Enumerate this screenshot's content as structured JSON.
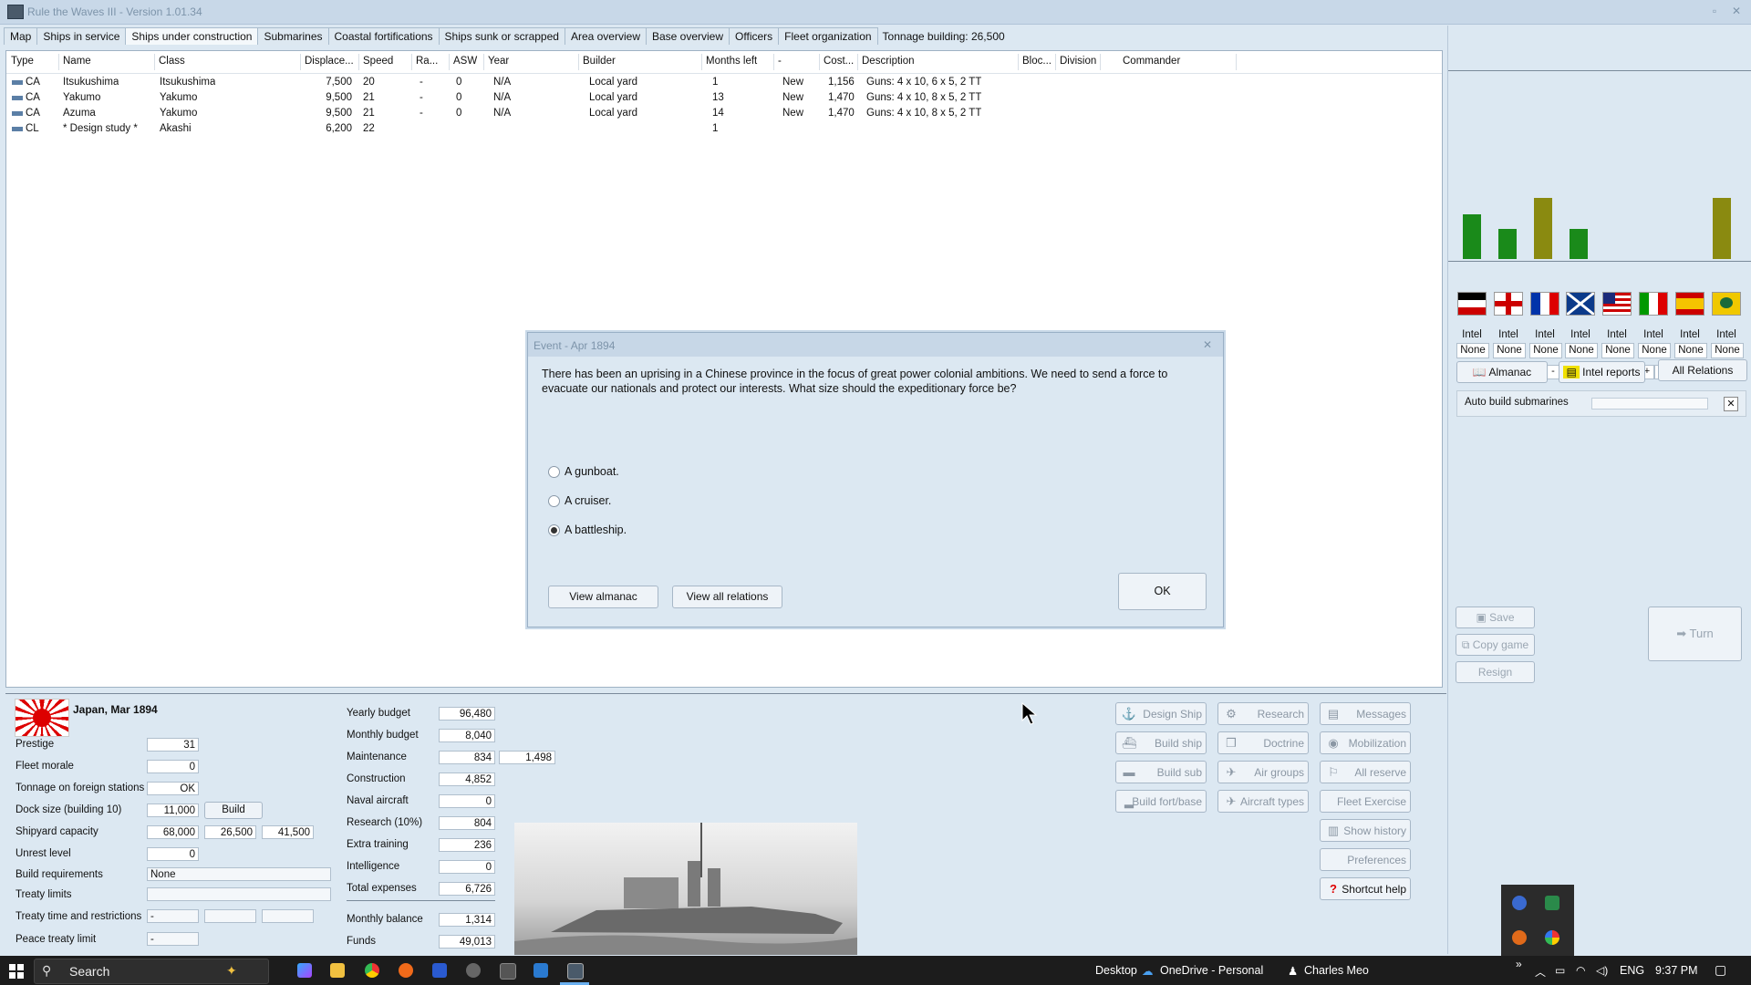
{
  "window": {
    "title": "Rule the Waves III - Version 1.01.34"
  },
  "tabs": [
    "Map",
    "Ships in service",
    "Ships under construction",
    "Submarines",
    "Coastal fortifications",
    "Ships sunk or scrapped",
    "Area overview",
    "Base overview",
    "Officers",
    "Fleet organization"
  ],
  "active_tab": "Ships under construction",
  "tonnage_building": "Tonnage building: 26,500",
  "table": {
    "columns": [
      "Type",
      "Name",
      "Class",
      "Displace...",
      "Speed",
      "Ra...",
      "ASW",
      "Year",
      "Builder",
      "Months left",
      "-",
      "Cost...",
      "Description",
      "Bloc...",
      "Division",
      "Commander"
    ],
    "rows": [
      {
        "type": "CA",
        "name": "Itsukushima",
        "class": "Itsukushima",
        "displacement": "7,500",
        "speed": "20",
        "range": "-",
        "asw": "0",
        "year": "N/A",
        "builder": "Local yard",
        "months": "1",
        "status": "New",
        "cost": "1,156",
        "desc": "Guns: 4 x 10, 6 x 5, 2 TT"
      },
      {
        "type": "CA",
        "name": "Yakumo",
        "class": "Yakumo",
        "displacement": "9,500",
        "speed": "21",
        "range": "-",
        "asw": "0",
        "year": "N/A",
        "builder": "Local yard",
        "months": "13",
        "status": "New",
        "cost": "1,470",
        "desc": "Guns: 4 x 10, 8 x 5, 2 TT"
      },
      {
        "type": "CA",
        "name": "Azuma",
        "class": "Yakumo",
        "displacement": "9,500",
        "speed": "21",
        "range": "-",
        "asw": "0",
        "year": "N/A",
        "builder": "Local yard",
        "months": "14",
        "status": "New",
        "cost": "1,470",
        "desc": "Guns: 4 x 10, 8 x 5, 2 TT"
      },
      {
        "type": "CL",
        "name": "* Design study *",
        "class": "Akashi",
        "displacement": "6,200",
        "speed": "22",
        "range": "",
        "asw": "",
        "year": "",
        "builder": "",
        "months": "1",
        "status": "",
        "cost": "",
        "desc": ""
      }
    ]
  },
  "nations": {
    "bar_levels": [
      0.56,
      0.38,
      0.76,
      0.38,
      0,
      0,
      0,
      0.76
    ],
    "bar_colors": [
      "#1a8a1a",
      "#1a8a1a",
      "#8a8a10",
      "#1a8a1a",
      "#1a8a1a",
      "#1a8a1a",
      "#1a8a1a",
      "#8a8a10"
    ],
    "intel_label": "Intel",
    "intel_values": [
      "None",
      "None",
      "None",
      "None",
      "None",
      "None",
      "None",
      "None"
    ],
    "plus": "+",
    "minus": "-"
  },
  "right_buttons": {
    "almanac": "Almanac",
    "intel_reports": "Intel reports",
    "all_relations": "All Relations",
    "auto_build": "Auto build submarines",
    "save": "Save",
    "copy_game": "Copy game",
    "resign": "Resign",
    "turn": "Turn"
  },
  "country": {
    "name_date": "Japan, Mar 1894"
  },
  "stats": {
    "prestige": {
      "label": "Prestige",
      "value": "31"
    },
    "fleet_morale": {
      "label": "Fleet morale",
      "value": "0"
    },
    "tonnage_foreign": {
      "label": "Tonnage on foreign stations",
      "value": "OK"
    },
    "dock_size": {
      "label": "Dock size (building 10)",
      "value": "11,000",
      "button": "Build"
    },
    "shipyard": {
      "label": "Shipyard capacity",
      "values": [
        "68,000",
        "26,500",
        "41,500"
      ]
    },
    "unrest": {
      "label": "Unrest level",
      "value": "0"
    },
    "build_req": {
      "label": "Build requirements",
      "value": "None"
    },
    "treaty_limits": {
      "label": "Treaty limits"
    },
    "treaty_time": {
      "label": "Treaty time and restrictions",
      "value": "-"
    },
    "peace_treaty": {
      "label": "Peace treaty limit",
      "value": "-"
    }
  },
  "budget": {
    "yearly": {
      "label": "Yearly budget",
      "value": "96,480"
    },
    "monthly": {
      "label": "Monthly budget",
      "value": "8,040"
    },
    "maintenance": {
      "label": "Maintenance",
      "value": "834",
      "value2": "1,498"
    },
    "construction": {
      "label": "Construction",
      "value": "4,852"
    },
    "naval_aircraft": {
      "label": "Naval aircraft",
      "value": "0"
    },
    "research": {
      "label": "Research (10%)",
      "value": "804"
    },
    "extra_training": {
      "label": "Extra training",
      "value": "236"
    },
    "intelligence": {
      "label": "Intelligence",
      "value": "0"
    },
    "total_expenses": {
      "label": "Total expenses",
      "value": "6,726"
    },
    "monthly_balance": {
      "label": "Monthly balance",
      "value": "1,314"
    },
    "funds": {
      "label": "Funds",
      "value": "49,013"
    }
  },
  "commands": [
    "Design Ship",
    "Research",
    "Messages",
    "Build ship",
    "Doctrine",
    "Mobilization",
    "Build sub",
    "Air groups",
    "All reserve",
    "Build fort/base",
    "Aircraft types",
    "Fleet Exercise",
    "Show history",
    "Preferences",
    "Shortcut help"
  ],
  "dialog": {
    "title": "Event - Apr 1894",
    "text": "There has been an uprising in a Chinese province in the focus of great power colonial ambitions. We need to send a force to evacuate our nationals and protect our interests. What size should the expeditionary force be?",
    "options": [
      "A gunboat.",
      "A cruiser.",
      "A battleship."
    ],
    "selected_index": 2,
    "view_almanac": "View almanac",
    "view_relations": "View all relations",
    "ok": "OK"
  },
  "taskbar": {
    "search": "Search",
    "desktop": "Desktop",
    "onedrive": "OneDrive - Personal",
    "user": "Charles Meo",
    "lang": "ENG",
    "time": "9:37 PM"
  }
}
